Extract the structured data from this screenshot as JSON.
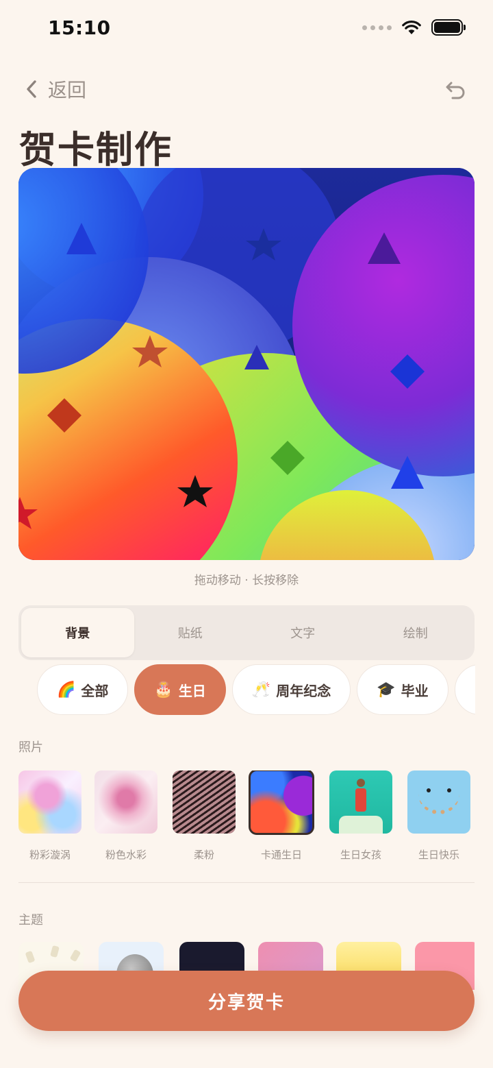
{
  "status": {
    "time": "15:10"
  },
  "nav": {
    "back_label": "返回"
  },
  "page": {
    "title": "贺卡制作",
    "canvas_hint": "拖动移动 · 长按移除"
  },
  "tabs": [
    {
      "label": "背景",
      "active": true
    },
    {
      "label": "贴纸",
      "active": false
    },
    {
      "label": "文字",
      "active": false
    },
    {
      "label": "绘制",
      "active": false
    }
  ],
  "chips": [
    {
      "emoji": "🌈",
      "label": "全部",
      "active": false
    },
    {
      "emoji": "🎂",
      "label": "生日",
      "active": true
    },
    {
      "emoji": "🥂",
      "label": "周年纪念",
      "active": false
    },
    {
      "emoji": "🎓",
      "label": "毕业",
      "active": false
    },
    {
      "emoji": "🎉",
      "label": "",
      "active": false
    }
  ],
  "sections": {
    "photos_label": "照片",
    "themes_label": "主题"
  },
  "photos": [
    {
      "label": "粉彩漩涡"
    },
    {
      "label": "粉色水彩"
    },
    {
      "label": "柔粉"
    },
    {
      "label": "卡通生日",
      "selected": true
    },
    {
      "label": "生日女孩"
    },
    {
      "label": "生日快乐"
    }
  ],
  "share_button": {
    "label": "分享贺卡"
  },
  "colors": {
    "accent": "#d87757",
    "background": "#fcf5ee",
    "text": "#3b2e2a",
    "muted": "#9d948e"
  }
}
